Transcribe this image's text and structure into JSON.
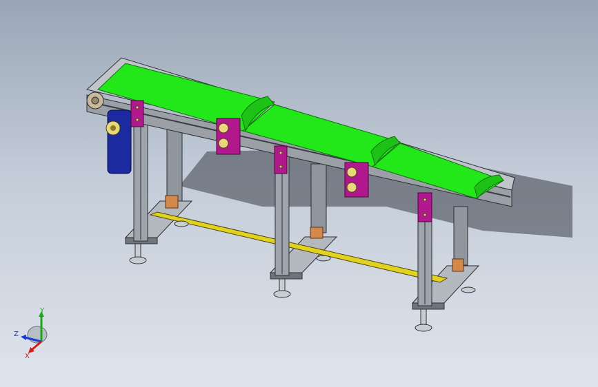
{
  "viewport": {
    "background_top": "#9aa6b6",
    "background_bottom": "#dfe4ec"
  },
  "model": {
    "belt_color": "#22e81a",
    "frame_color": "#9aa0a6",
    "bracket_color": "#b2188e",
    "motor_color": "#1b2a9e",
    "tie_bar_color": "#e0d21e",
    "pad_color": "#d4884a"
  },
  "triad": {
    "y_label": "Y",
    "z_label": "Z",
    "x_label": "X",
    "y_color": "#1aa81a",
    "z_color": "#1a3ad8",
    "x_color": "#d81a1a"
  }
}
